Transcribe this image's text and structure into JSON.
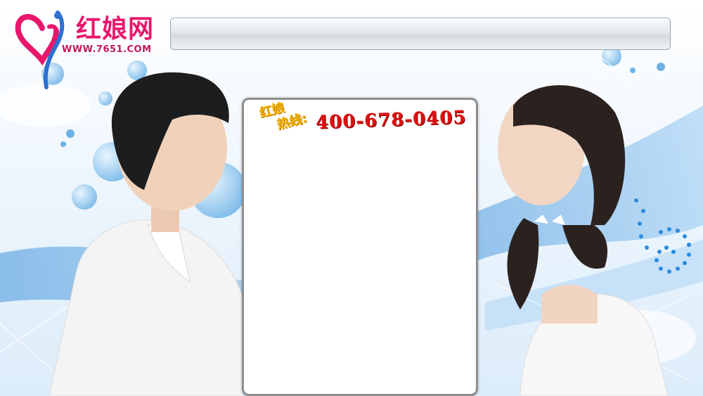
{
  "logo": {
    "name": "红娘网",
    "url": "WWW.7651.COM"
  },
  "hotline": {
    "label_line1": "红娘",
    "label_line2": "热线:",
    "number": "400-678-0405"
  },
  "colors": {
    "brand_pink": "#e8176c",
    "hotline_yellow": "#f4b400",
    "hotline_red": "#e01010",
    "sky_blue": "#5aa9e6"
  },
  "icons": {
    "logo_mark": "heart-cupid-icon"
  }
}
